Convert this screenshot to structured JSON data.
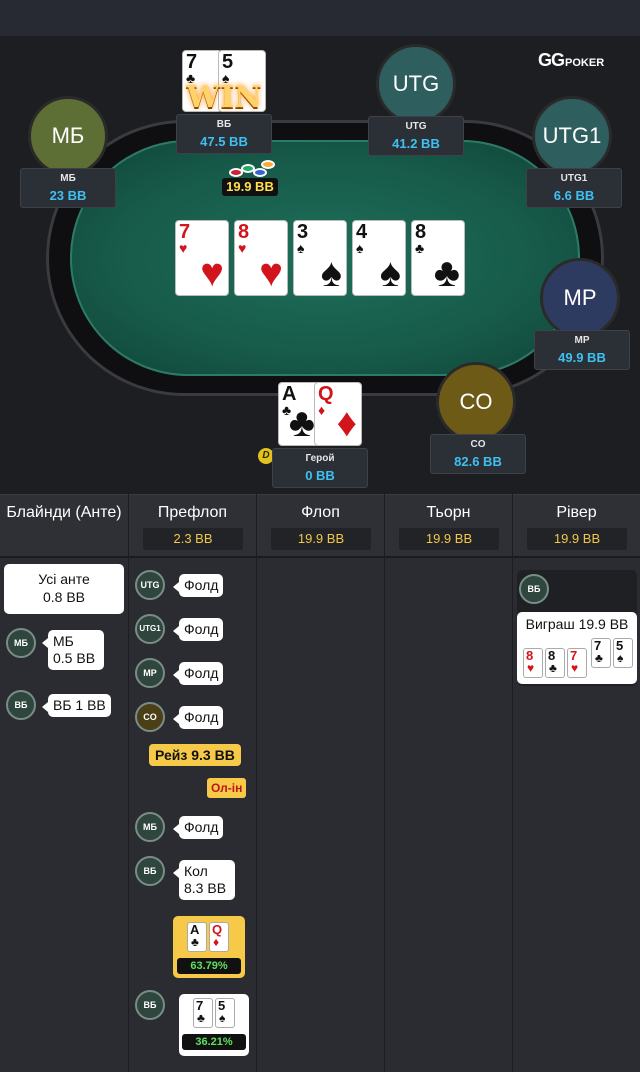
{
  "brand": {
    "logo_gg": "GG",
    "logo_poker": "POKER"
  },
  "table": {
    "pot": "19.9 BB",
    "win_badge": "WIN",
    "dealer": "D",
    "community_cards": [
      {
        "rank": "7",
        "suit": "♥",
        "color": "red"
      },
      {
        "rank": "8",
        "suit": "♥",
        "color": "red"
      },
      {
        "rank": "3",
        "suit": "♠",
        "color": "black"
      },
      {
        "rank": "4",
        "suit": "♠",
        "color": "black"
      },
      {
        "rank": "8",
        "suit": "♣",
        "color": "black"
      }
    ],
    "seats": [
      {
        "id": "mb",
        "avatar": "МБ",
        "name": "МБ",
        "stack": "23 BB",
        "color": "#5e6f36"
      },
      {
        "id": "bb",
        "avatar": "",
        "name": "ВБ",
        "stack": "47.5 BB",
        "color": "#3b3b3b"
      },
      {
        "id": "utg",
        "avatar": "UTG",
        "name": "UTG",
        "stack": "41.2 BB",
        "color": "#2f5e5e"
      },
      {
        "id": "utg1",
        "avatar": "UTG1",
        "name": "UTG1",
        "stack": "6.6 BB",
        "color": "#2f5e5e"
      },
      {
        "id": "mp",
        "avatar": "MP",
        "name": "MP",
        "stack": "49.9 BB",
        "color": "#2e3b60"
      },
      {
        "id": "co",
        "avatar": "CO",
        "name": "CO",
        "stack": "82.6 BB",
        "color": "#6e5a17"
      },
      {
        "id": "hero",
        "avatar": "",
        "name": "Герой",
        "stack": "0 BB",
        "color": "#8b2a2a"
      }
    ],
    "bb_cards": [
      {
        "rank": "7",
        "suit": "♣"
      },
      {
        "rank": "5",
        "suit": "♠"
      }
    ],
    "hero_cards": [
      {
        "rank": "A",
        "suit": "♣",
        "color": "black"
      },
      {
        "rank": "Q",
        "suit": "♦",
        "color": "red"
      }
    ]
  },
  "history": {
    "columns": [
      {
        "label": "Блайнди (Анте)",
        "pot": ""
      },
      {
        "label": "Префлоп",
        "pot": "2.3 BB"
      },
      {
        "label": "Флоп",
        "pot": "19.9 BB"
      },
      {
        "label": "Тьорн",
        "pot": "19.9 BB"
      },
      {
        "label": "Рівер",
        "pot": "19.9 BB"
      }
    ],
    "blinds": {
      "ante_line1": "Усі анте",
      "ante_line2": "0.8 BB",
      "sb_badge": "МБ",
      "sb_line1": "МБ",
      "sb_line2": "0.5 BB",
      "bb_badge": "ВБ",
      "bb_text": "ВБ 1 BB"
    },
    "preflop": {
      "actions": [
        {
          "badge": "UTG",
          "text": "Фолд"
        },
        {
          "badge": "UTG1",
          "text": "Фолд"
        },
        {
          "badge": "MP",
          "text": "Фолд"
        },
        {
          "badge": "CO",
          "text": "Фолд"
        }
      ],
      "raise": "Рейз 9.3 BB",
      "allin": "Ол-ін",
      "mb_badge": "МБ",
      "mb_action": "Фолд",
      "bb_badge": "ВБ",
      "bb_action_line1": "Кол",
      "bb_action_line2": "8.3 BB",
      "hero_equity": "63.79%",
      "bb2_badge": "ВБ",
      "bb_equity": "36.21%"
    },
    "river": {
      "badge": "ВБ",
      "win_text": "Виграш 19.9 BB",
      "hand_cards": [
        {
          "rank": "8",
          "suit": "♥",
          "color": "red"
        },
        {
          "rank": "8",
          "suit": "♣",
          "color": "black"
        },
        {
          "rank": "7",
          "suit": "♥",
          "color": "red"
        },
        {
          "rank": "7",
          "suit": "♣",
          "color": "black"
        },
        {
          "rank": "5",
          "suit": "♠",
          "color": "black"
        }
      ]
    }
  },
  "colors": {
    "accent_gold": "#f7c948",
    "stack_blue": "#3ec1f2",
    "felt": "#1f6e5b"
  }
}
